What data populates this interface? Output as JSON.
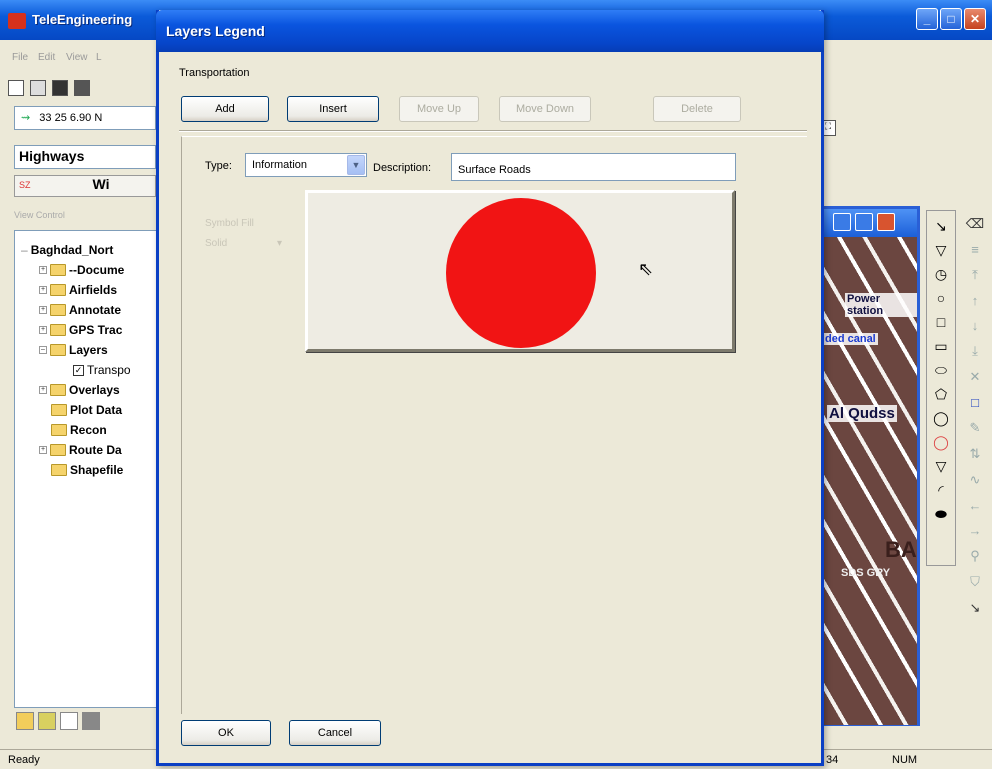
{
  "main_window": {
    "title": "TeleEngineering",
    "menu": [
      "File",
      "Edit",
      "View",
      "L"
    ],
    "coordinate": "33 25 6.90 N",
    "highways_label": "Highways",
    "wi_label": "Wi",
    "sz_label": "SZ",
    "view_control_label": "View Control",
    "tree": {
      "root": "Baghdad_Nort",
      "items": [
        "--Docume",
        "Airfields",
        "Annotate",
        "GPS Trac",
        "Layers",
        "Transpo",
        "Overlays",
        "Plot Data",
        "Recon",
        "Route Da",
        "Shapefile"
      ]
    },
    "map_labels": [
      "Power station",
      "ded canal",
      "Al Qudss",
      "BA",
      "SDS GRY"
    ],
    "status": {
      "ready": "Ready",
      "num": "NUM",
      "n34": "34"
    },
    "draw_tools": [
      "line-tool",
      "polygon-tool",
      "circle-tool",
      "ellipse-tool",
      "square-tool",
      "rectangle-tool",
      "oval-tool",
      "pentagon-tool",
      "circle-outline-tool",
      "red-circle-tool",
      "pin-tool",
      "arc-tool",
      "rounded-tool"
    ]
  },
  "dialog": {
    "title": "Layers Legend",
    "group_label": "Transportation",
    "buttons": {
      "add": "Add",
      "insert": "Insert",
      "move_up": "Move Up",
      "move_down": "Move Down",
      "delete": "Delete",
      "ok": "OK",
      "cancel": "Cancel"
    },
    "type_label": "Type:",
    "type_value": "Information",
    "description_label": "Description:",
    "description_value": "Surface Roads",
    "ghost_label_1": "Symbol Fill",
    "ghost_label_2": "Solid",
    "symbol_color": "#f11414"
  },
  "colors": {
    "titlebar": "#0a55df",
    "dialog_bg": "#ece9d8",
    "symbol": "#f11414"
  }
}
